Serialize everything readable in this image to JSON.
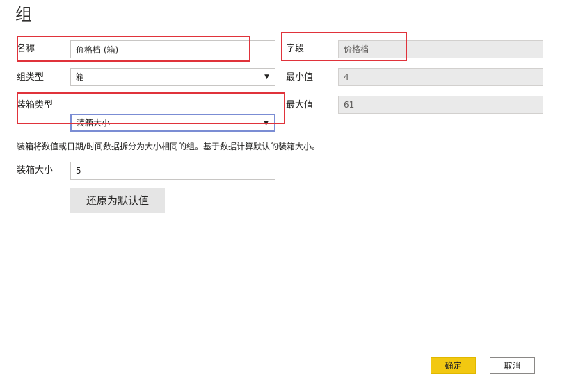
{
  "dialog": {
    "title": "组"
  },
  "form": {
    "name_label": "名称",
    "name_value": "价格档 (箱)",
    "field_label": "字段",
    "field_value": "价格档",
    "group_type_label": "组类型",
    "group_type_value": "箱",
    "min_label": "最小值",
    "min_value": "4",
    "bin_type_label": "装箱类型",
    "bin_type_value": "装箱大小",
    "max_label": "最大值",
    "max_value": "61",
    "description": "装箱将数值或日期/时间数据拆分为大小相同的组。基于数据计算默认的装箱大小。",
    "bin_size_label": "装箱大小",
    "bin_size_value": "5",
    "reset_label": "还原为默认值"
  },
  "footer": {
    "ok_label": "确定",
    "cancel_label": "取消"
  },
  "icons": {
    "dropdown": "chevron-down-icon"
  },
  "colors": {
    "highlight": "#e0333b",
    "ok_button": "#f2c811",
    "readonly_field": "#eaeaea"
  }
}
